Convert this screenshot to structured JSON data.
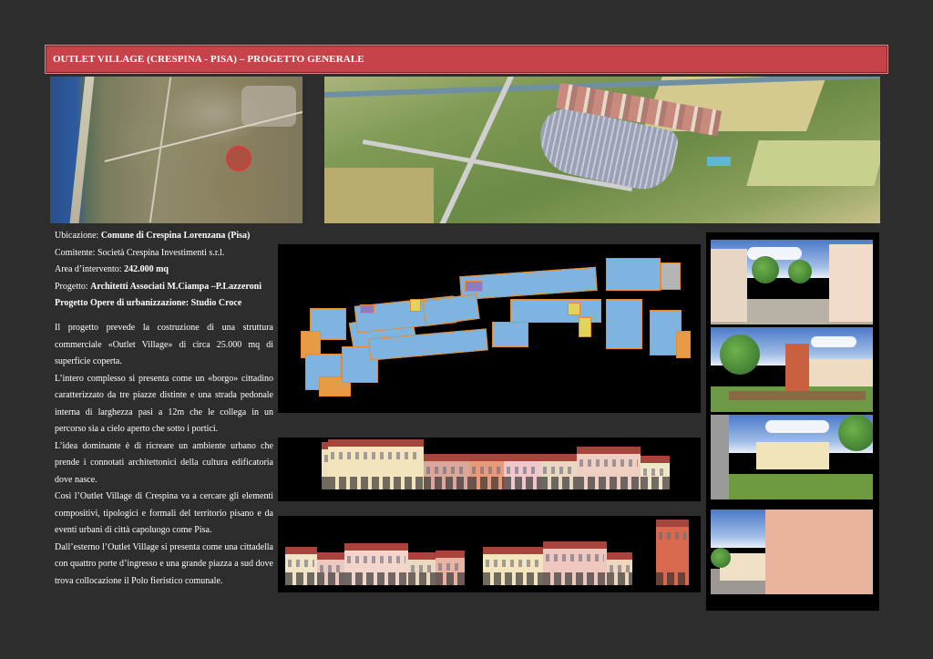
{
  "title": "OUTLET VILLAGE (CRESPINA - PISA) – PROGETTO GENERALE",
  "meta": [
    {
      "label": "Ubicazione: ",
      "value": "Comune di Crespina Lorenzana (Pisa)"
    },
    {
      "label": "Comitente: ",
      "value": "Società Crespina Investimenti s.r.l."
    },
    {
      "label": "Area d’intervento: ",
      "value": "242.000 mq"
    },
    {
      "label": "Progetto: ",
      "value": "Architetti Associati M.Ciampa –P.Lazzeroni"
    },
    {
      "label": "",
      "value": "Progetto Opere di urbanizzazione: Studio Croce"
    }
  ],
  "paragraphs": [
    "Il progetto prevede la costruzione di una struttura commerciale «Outlet Village» di circa 25.000 mq di superficie coperta.",
    "L’intero complesso si presenta come un «borgo» cittadino caratterizzato da tre piazze distinte e una strada pedonale interna di larghezza pasi a 12m che le collega in un percorso sia a cielo aperto che sotto i portici.",
    "L’idea dominante è di ricreare un ambiente urbano che prende i connotati architettonici della cultura edificatoria dove nasce.",
    "Così l’Outlet Village di Crespina va a cercare gli elementi compositivi, tipologici e formali del territorio pisano e da eventi urbani di città capoluogo come Pisa.",
    "Dall’esterno l’Outlet Village si presenta come una cittadella con quattro porte d’ingresso e una grande piazza a sud dove trova collocazione il Polo fieristico comunale."
  ],
  "colors": {
    "page_bg": "#2d2d2d",
    "title_bar": "#c6434a",
    "text": "#ffffff"
  }
}
